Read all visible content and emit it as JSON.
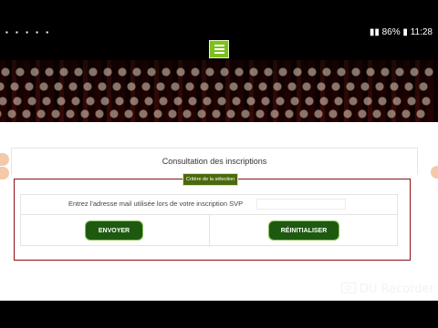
{
  "status_bar": {
    "left_icons": [
      "usb-icon",
      "message-icon",
      "image-icon",
      "cloud-icon",
      "game-icon"
    ],
    "right_icons": [
      "nfc-icon",
      "wifi-icon",
      "signal-icon",
      "battery-icon"
    ],
    "battery": "86%",
    "time": "11:28"
  },
  "header": {
    "menu_icon": "hamburger-icon"
  },
  "panel": {
    "title": "Consultation des inscriptions",
    "legend": "Critère de la sélection",
    "prompt": "Entrez l'adresse mail utilisée lors de votre inscription SVP",
    "email_value": "",
    "send_label": "ENVOYER",
    "reset_label": "RÉINITIALISER"
  },
  "watermark": {
    "text": "DU Recorder"
  },
  "colors": {
    "accent_green": "#7cc11b",
    "button_green": "#1d5a10",
    "frame_red": "#8b0e14"
  }
}
